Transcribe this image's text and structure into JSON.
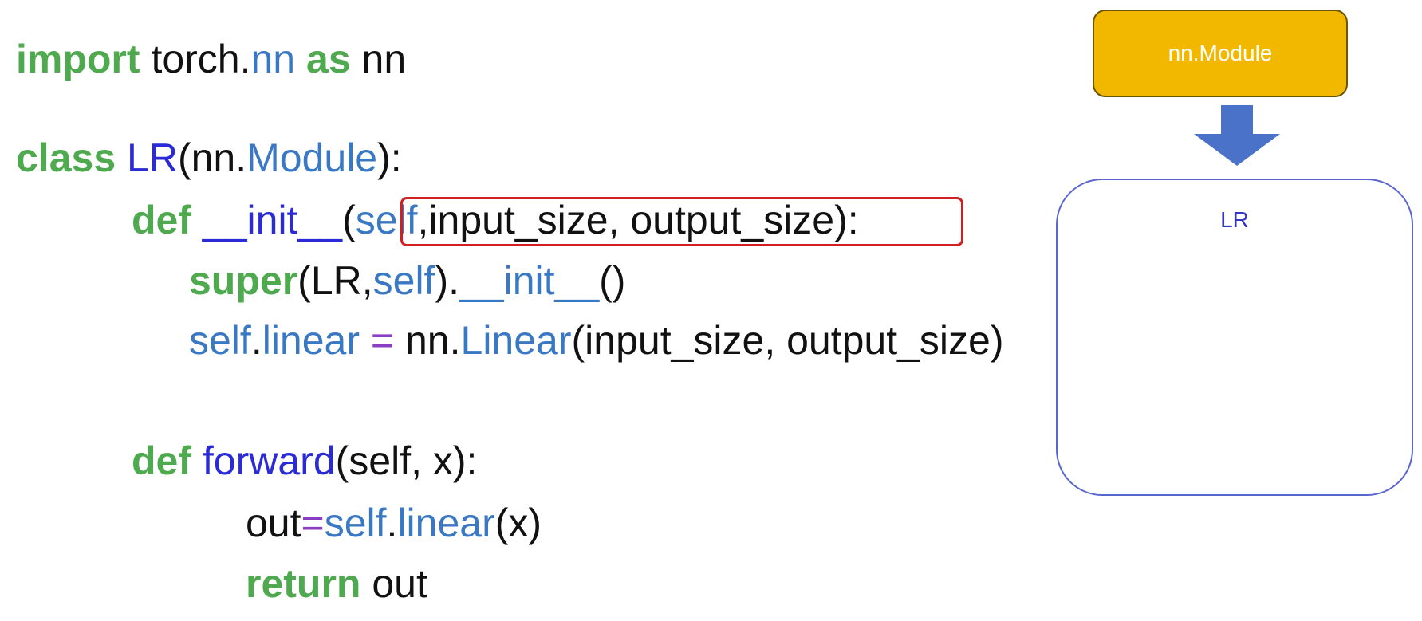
{
  "code": {
    "line1": {
      "import": "import",
      "torch": " torch.",
      "nn": "nn",
      "as": " as",
      "alias": " nn"
    },
    "line2": {
      "class": "class",
      "sp": " ",
      "name": "LR",
      "paren_open": "(nn.",
      "base": "Module",
      "paren_close": "):"
    },
    "line3": {
      "def": "def",
      "sp": " ",
      "init": "__init__",
      "open": "(",
      "self": "self",
      "args": ",input_size, output_size",
      "close": "):"
    },
    "line4": {
      "super": "super",
      "args_open": "(LR,",
      "self": "self",
      "close": ").",
      "init": "__init__",
      "call": "()"
    },
    "line5": {
      "self": "self",
      "dot": ".",
      "linear": "linear",
      "eq": " = ",
      "nn": "nn.",
      "Linear": "Linear",
      "args": "(input_size, output_size)"
    },
    "line6": {
      "def": "def",
      "sp": " ",
      "forward": "forward",
      "args": "(self, x):"
    },
    "line7": {
      "out": "out",
      "eq": "=",
      "self": "self",
      "dot": ".",
      "linear": "linear",
      "args": "(x)"
    },
    "line8": {
      "return": "return",
      "out": " out"
    }
  },
  "diagram": {
    "parent_label": "nn.Module",
    "child_label": "LR",
    "colors": {
      "parent_fill": "#f2b800",
      "arrow": "#4a72c8",
      "child_border": "#5a66d0"
    }
  }
}
